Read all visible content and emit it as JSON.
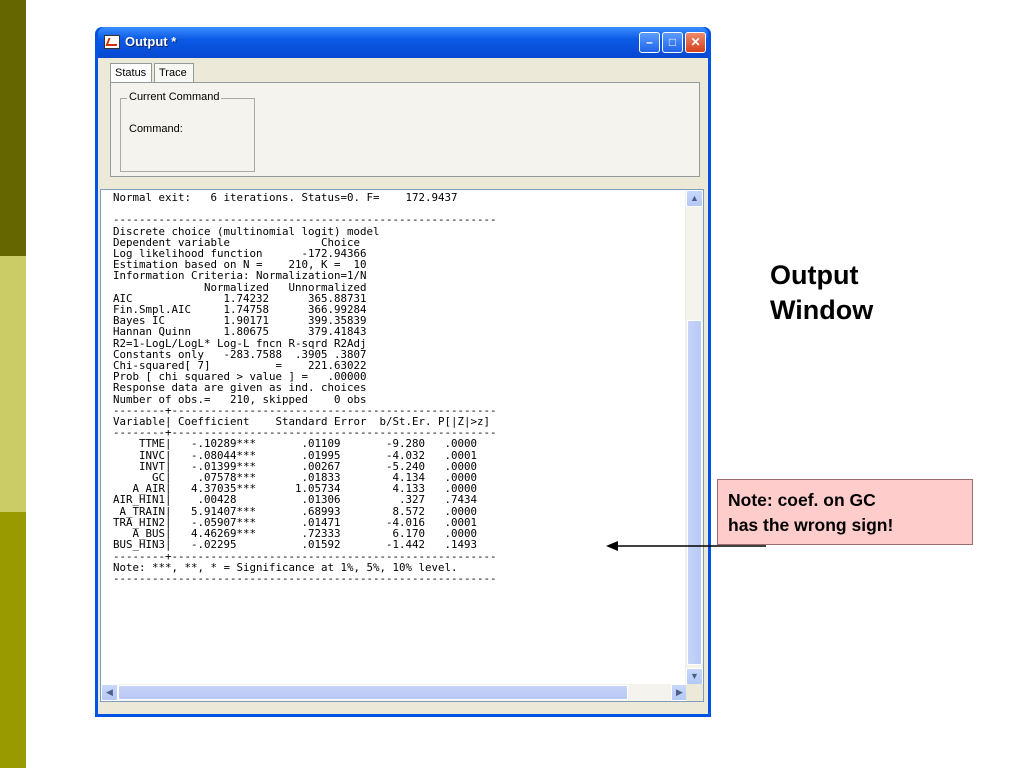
{
  "window": {
    "title": "Output *",
    "buttons": {
      "minimize": "–",
      "maximize": "□",
      "close": "✕"
    }
  },
  "tabs": [
    {
      "label": "Status"
    },
    {
      "label": "Trace"
    }
  ],
  "current_command": {
    "legend": "Current Command",
    "label": "Command:"
  },
  "output_lines": [
    "Normal exit:   6 iterations. Status=0. F=    172.9437",
    "",
    "-----------------------------------------------------------",
    "Discrete choice (multinomial logit) model",
    "Dependent variable              Choice",
    "Log likelihood function      -172.94366",
    "Estimation based on N =    210, K =  10",
    "Information Criteria: Normalization=1/N",
    "              Normalized   Unnormalized",
    "AIC              1.74232      365.88731",
    "Fin.Smpl.AIC     1.74758      366.99284",
    "Bayes IC         1.90171      399.35839",
    "Hannan Quinn     1.80675      379.41843",
    "R2=1-LogL/LogL* Log-L fncn R-sqrd R2Adj",
    "Constants only   -283.7588  .3905 .3807",
    "Chi-squared[ 7]          =    221.63022",
    "Prob [ chi squared > value ] =   .00000",
    "Response data are given as ind. choices",
    "Number of obs.=   210, skipped    0 obs",
    "--------+--------------------------------------------------",
    "Variable| Coefficient    Standard Error  b/St.Er. P[|Z|>z]",
    "--------+--------------------------------------------------",
    "    TTME|   -.10289***       .01109       -9.280   .0000",
    "    INVC|   -.08044***       .01995       -4.032   .0001",
    "    INVT|   -.01399***       .00267       -5.240   .0000",
    "      GC|    .07578***       .01833        4.134   .0000",
    "   A_AIR|   4.37035***      1.05734        4.133   .0000",
    "AIR_HIN1|    .00428          .01306         .327   .7434",
    " A_TRAIN|   5.91407***       .68993        8.572   .0000",
    "TRA_HIN2|   -.05907***       .01471       -4.016   .0001",
    "   A_BUS|   4.46269***       .72333        6.170   .0000",
    "BUS_HIN3|   -.02295          .01592       -1.442   .1493",
    "--------+--------------------------------------------------",
    "Note: ***, **, * = Significance at 1%, 5%, 10% level.",
    "-----------------------------------------------------------"
  ],
  "scroll_arrows": {
    "up": "▲",
    "down": "▼",
    "left": "◀",
    "right": "▶"
  },
  "annotation": {
    "heading_line1": "Output",
    "heading_line2": "Window",
    "note_line1": "Note:  coef. on GC",
    "note_line2": "has the wrong sign!"
  },
  "colors": {
    "titlebar": "#0a5ae6",
    "note_fill": "#ffcccc",
    "strip_dark": "#666600",
    "strip_light": "#cccc66",
    "strip_mid": "#999900"
  }
}
